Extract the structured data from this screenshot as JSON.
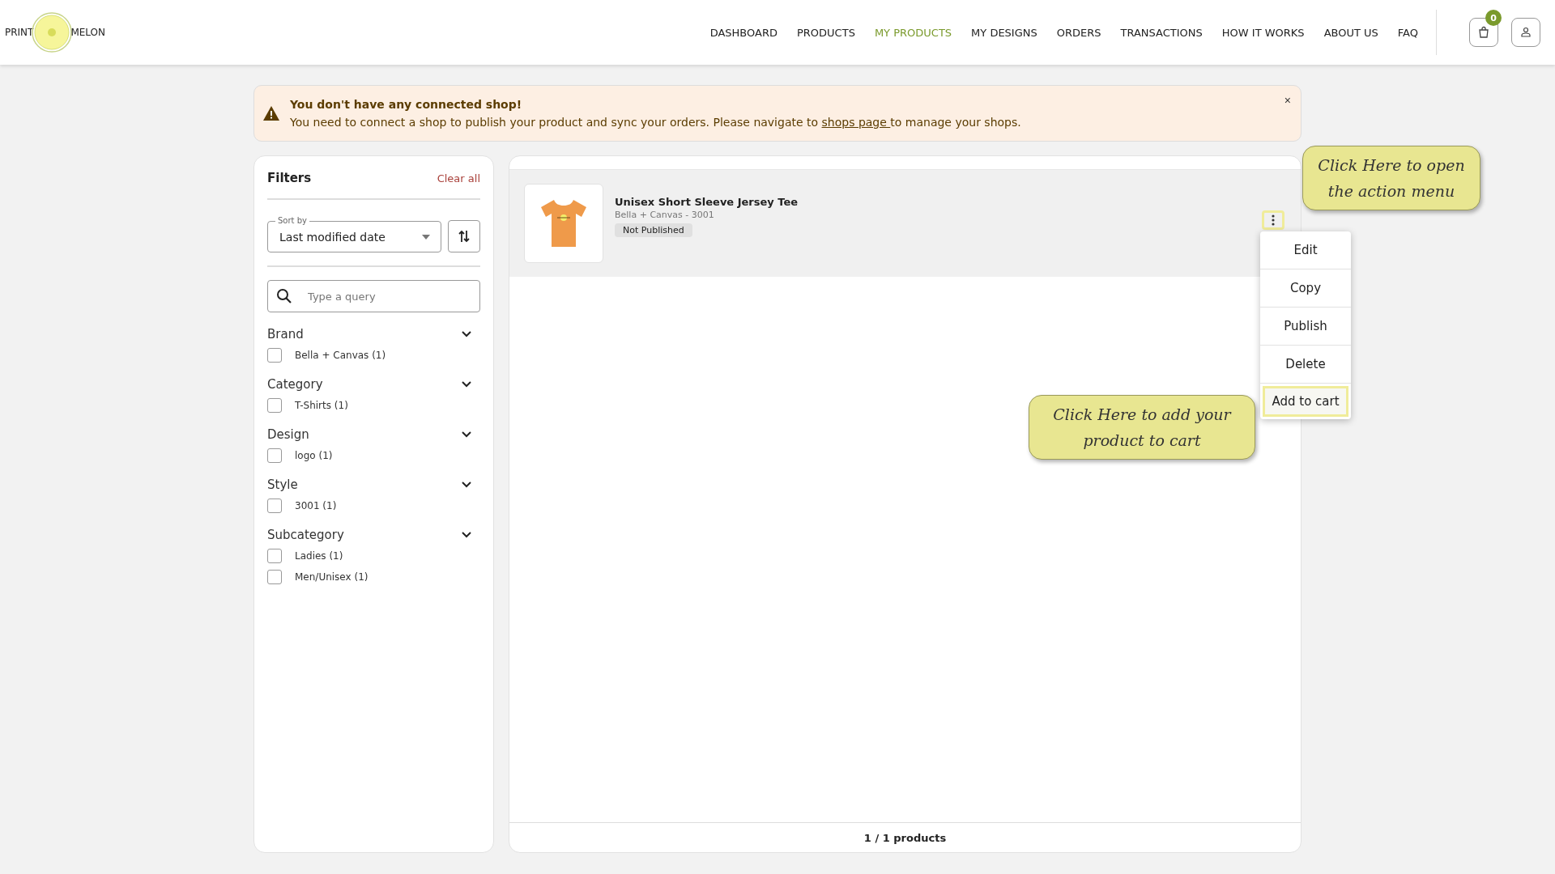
{
  "logo": {
    "left": "PRINT",
    "right": "MELON"
  },
  "nav": [
    {
      "label": "DASHBOARD",
      "selected": false
    },
    {
      "label": "PRODUCTS",
      "selected": false
    },
    {
      "label": "MY PRODUCTS",
      "selected": true
    },
    {
      "label": "MY DESIGNS",
      "selected": false
    },
    {
      "label": "ORDERS",
      "selected": false
    },
    {
      "label": "TRANSACTIONS",
      "selected": false
    },
    {
      "label": "HOW IT WORKS",
      "selected": false
    },
    {
      "label": "ABOUT US",
      "selected": false
    },
    {
      "label": "FAQ",
      "selected": false
    }
  ],
  "cart_count": "0",
  "alert": {
    "title": "You don't have any connected shop!",
    "text_before": "You need to connect a shop to publish your product and sync your orders. Please navigate to",
    "link": "shops page ",
    "text_after": "to manage your shops.",
    "close": "×"
  },
  "filters": {
    "title": "Filters",
    "clear": "Clear all",
    "sort_label": "Sort by",
    "sort_value": "Last modified date",
    "search_placeholder": "Type a query",
    "groups": [
      {
        "name": "Brand",
        "expanded": true,
        "options": [
          {
            "label": "Bella + Canvas (1)",
            "checked": false
          }
        ]
      },
      {
        "name": "Category",
        "expanded": true,
        "options": [
          {
            "label": "T-Shirts (1)",
            "checked": false
          }
        ]
      },
      {
        "name": "Design",
        "expanded": true,
        "options": [
          {
            "label": "logo (1)",
            "checked": false
          }
        ]
      },
      {
        "name": "Style",
        "expanded": true,
        "options": [
          {
            "label": "3001 (1)",
            "checked": false
          }
        ]
      },
      {
        "name": "Subcategory",
        "expanded": true,
        "options": [
          {
            "label": "Ladies (1)",
            "checked": false
          },
          {
            "label": "Men/Unisex (1)",
            "checked": false
          }
        ]
      }
    ]
  },
  "products": [
    {
      "name": "Unisex Short Sleeve Jersey Tee",
      "subtitle": "Bella + Canvas - 3001",
      "status": "Not Published",
      "menu_highlighted": true,
      "menu": [
        {
          "label": "Edit",
          "highlighted": false
        },
        {
          "label": "Copy",
          "highlighted": false
        },
        {
          "label": "Publish",
          "highlighted": false
        },
        {
          "label": "Delete",
          "highlighted": false
        },
        {
          "label": "Add to cart",
          "highlighted": true
        }
      ]
    }
  ],
  "count": "1 / 1 products",
  "callouts": [
    {
      "text": "Click Here to open the action menu"
    },
    {
      "text": "Click Here to add your product to cart"
    }
  ]
}
